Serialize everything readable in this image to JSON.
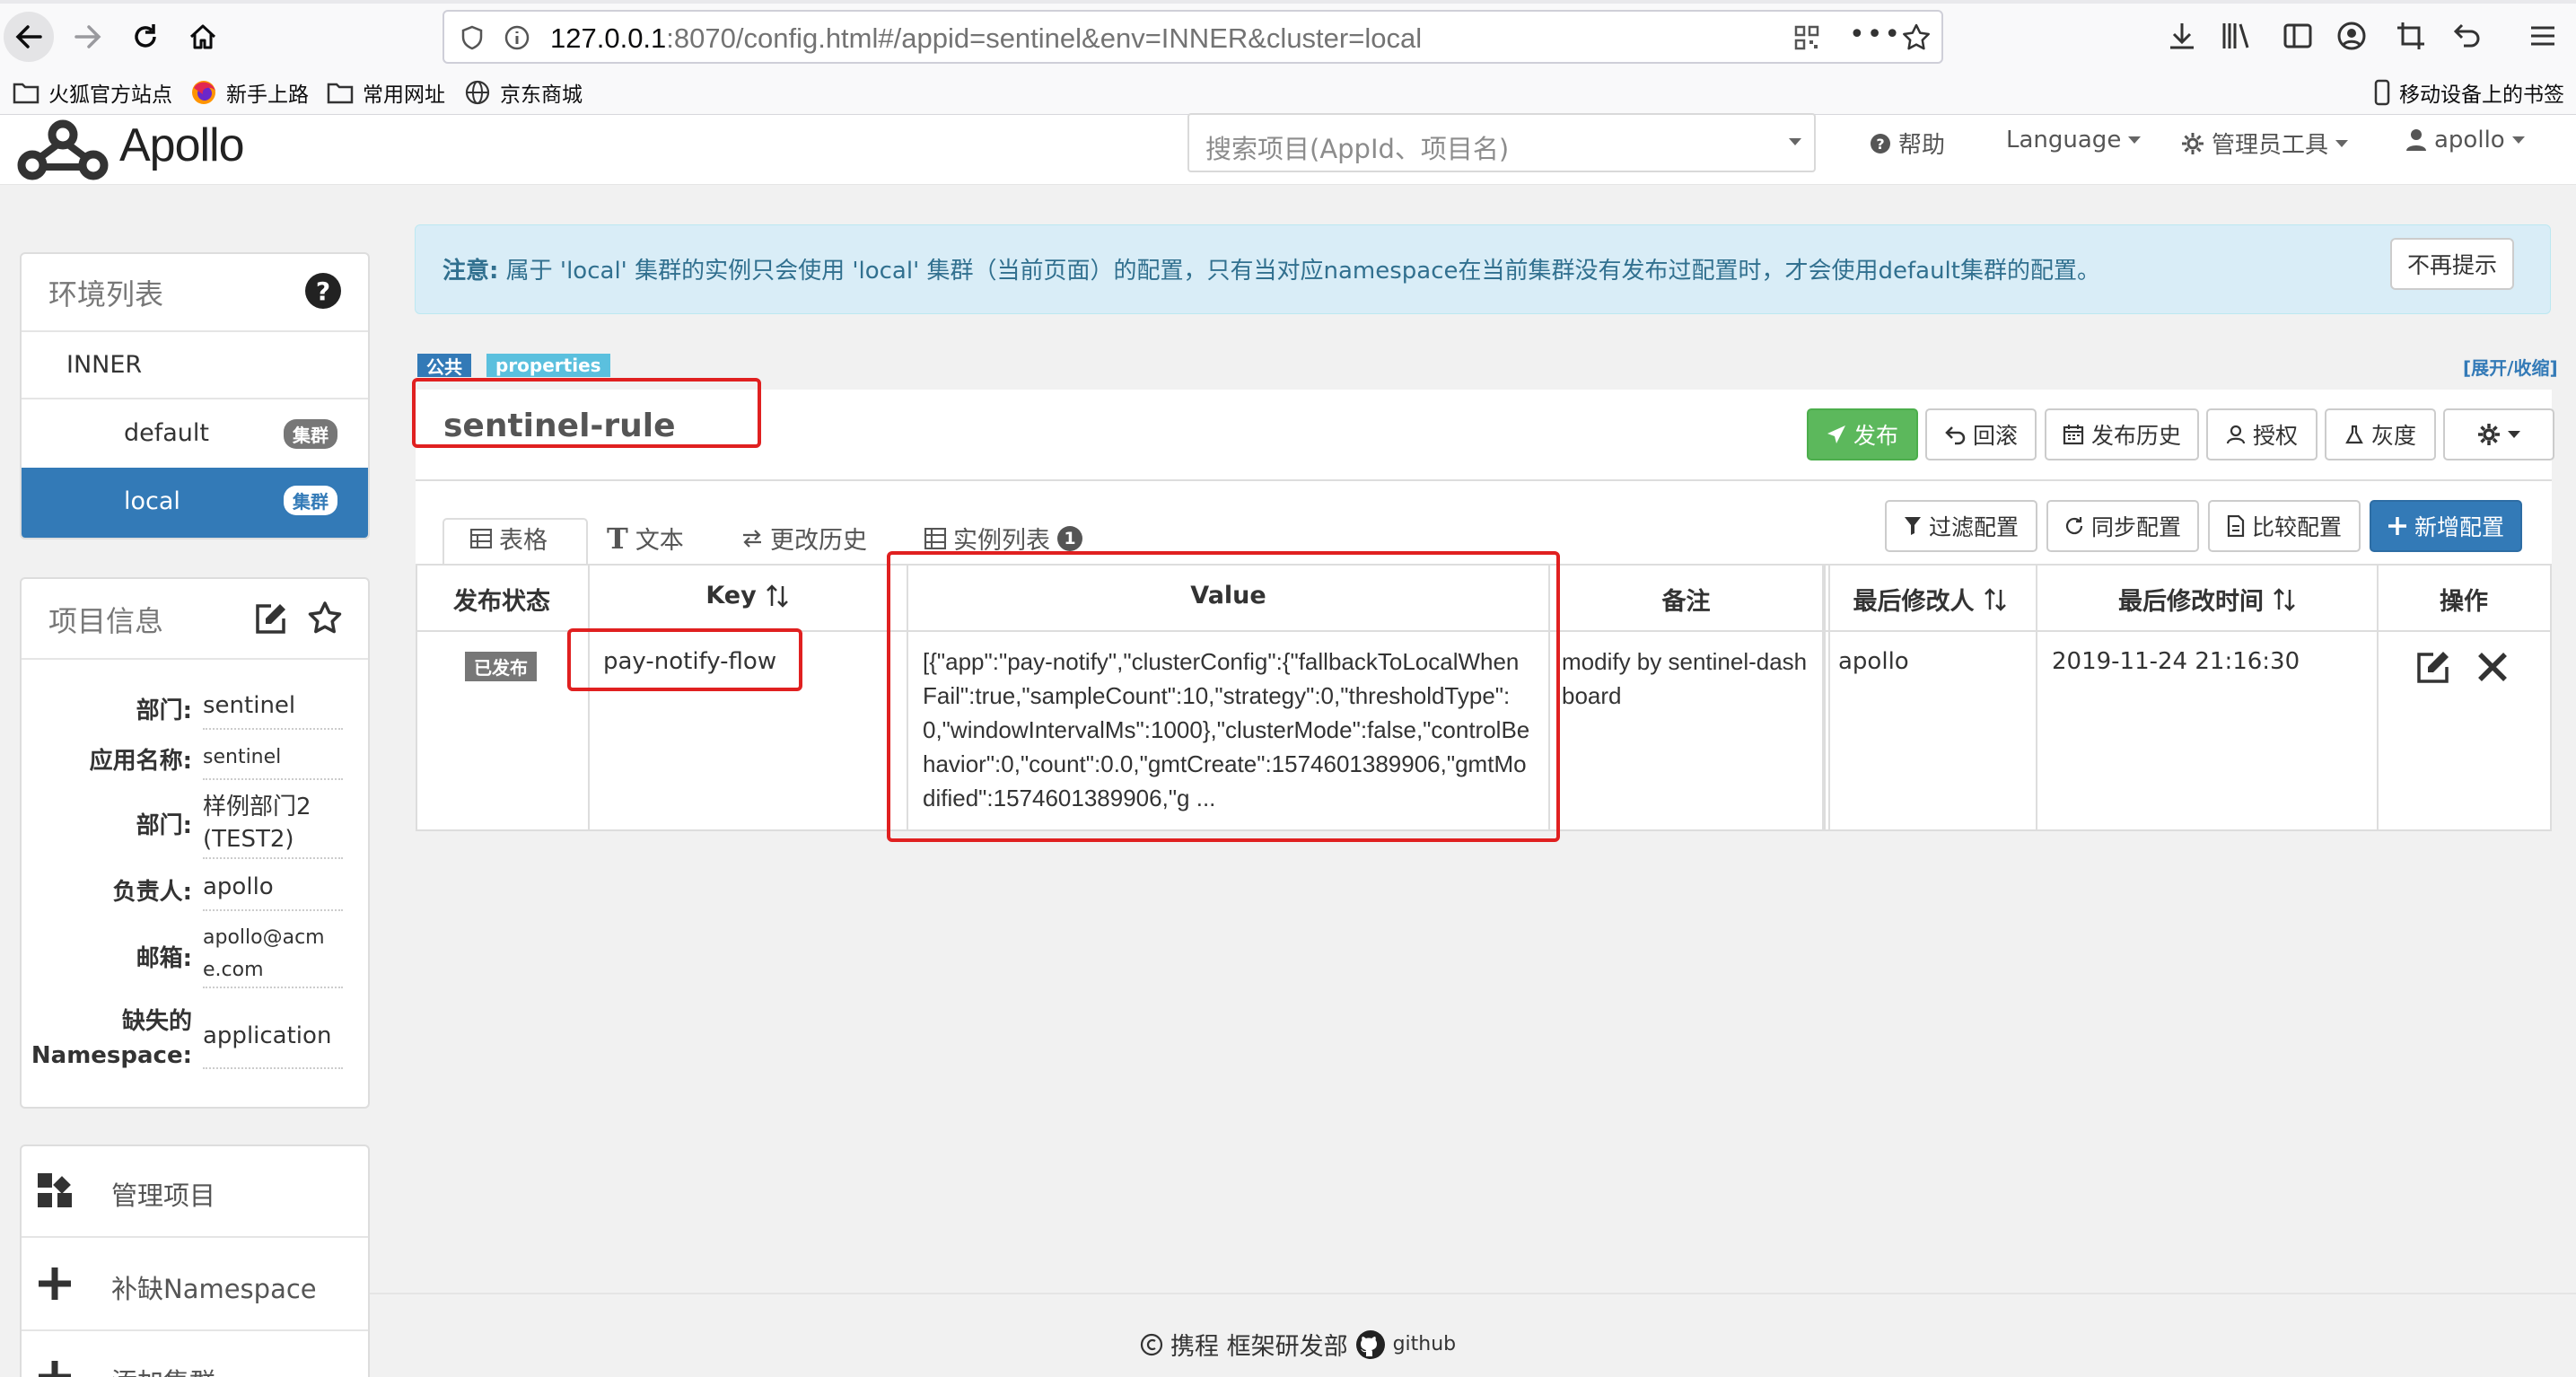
{
  "browser": {
    "url_host": "127.0.0.1",
    "url_path": ":8070/config.html#/appid=sentinel&env=INNER&cluster=local",
    "bookmarks": [
      "火狐官方站点",
      "新手上路",
      "常用网址",
      "京东商城"
    ],
    "mobile_bookmarks": "移动设备上的书签"
  },
  "header": {
    "brand": "Apollo",
    "search_placeholder": "搜索项目(AppId、项目名)",
    "help": "帮助",
    "language": "Language",
    "admin_tools": "管理员工具",
    "user": "apollo"
  },
  "alert": {
    "prefix": "注意:",
    "message": " 属于 'local' 集群的实例只会使用 'local' 集群（当前页面）的配置，只有当对应namespace在当前集群没有发布过配置时，才会使用default集群的配置。",
    "dismiss": "不再提示"
  },
  "env_panel": {
    "title": "环境列表",
    "env": "INNER",
    "clusters": [
      {
        "name": "default",
        "badge": "集群"
      },
      {
        "name": "local",
        "badge": "集群"
      }
    ]
  },
  "project_panel": {
    "title": "项目信息",
    "rows": [
      {
        "label": "部门:",
        "value": "sentinel"
      },
      {
        "label": "应用名称:",
        "value": "sentinel"
      },
      {
        "label": "部门:",
        "value": "样例部门2 (TEST2)"
      },
      {
        "label": "负责人:",
        "value": "apollo"
      },
      {
        "label": "邮箱:",
        "value": "apollo@acme.com"
      },
      {
        "label": "缺失的 Namespace:",
        "value": "application"
      }
    ]
  },
  "actions_panel": {
    "manage_project": "管理项目",
    "add_namespace": "补缺Namespace",
    "add_cluster": "添加集群"
  },
  "namespace": {
    "tag_public": "公共",
    "tag_format": "properties",
    "expand_toggle": "[展开/收缩]",
    "name": "sentinel-rule",
    "buttons": {
      "publish": "发布",
      "rollback": "回滚",
      "history": "发布历史",
      "authorize": "授权",
      "gray": "灰度"
    },
    "tabs": {
      "table": "表格",
      "text": "文本",
      "change_history": "更改历史",
      "instances": "实例列表",
      "instances_count": "1"
    },
    "tools": {
      "filter": "过滤配置",
      "sync": "同步配置",
      "compare": "比较配置",
      "add": "新增配置"
    },
    "columns": [
      "发布状态",
      "Key",
      "Value",
      "备注",
      "最后修改人",
      "最后修改时间",
      "操作"
    ],
    "rows": [
      {
        "status": "已发布",
        "key": "pay-notify-flow",
        "value_lines": [
          "[{\"app\":\"pay-notify\",\"clusterConfig\":{\"fallbackToLocalWhen",
          "Fail\":true,\"sampleCount\":10,\"strategy\":0,\"thresholdType\":",
          "0,\"windowIntervalMs\":1000},\"clusterMode\":false,\"controlBe",
          "havior\":0,\"count\":0.0,\"gmtCreate\":1574601389906,\"gmtMo",
          "dified\":1574601389906,\"g ..."
        ],
        "comment_lines": [
          "modify by sentinel-dash",
          "board"
        ],
        "modifier": "apollo",
        "modified_time": "2019-11-24 21:16:30"
      }
    ]
  },
  "footer": {
    "company": "携程 框架研发部",
    "github": "github"
  }
}
